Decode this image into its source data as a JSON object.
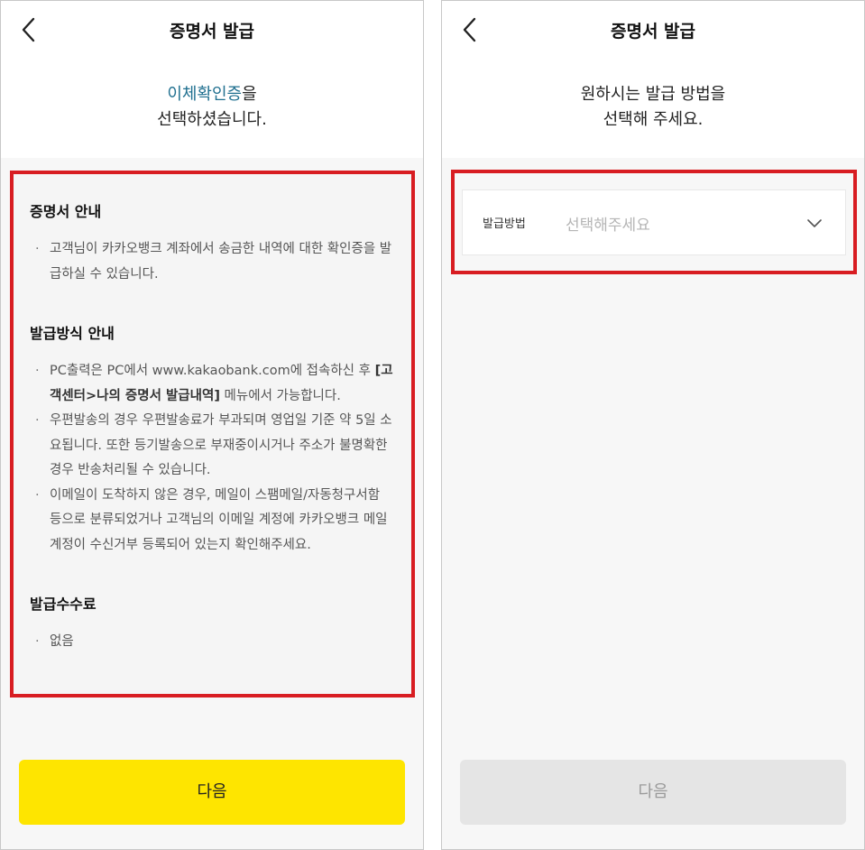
{
  "left": {
    "title": "증명서 발급",
    "headline": {
      "accent": "이체확인증",
      "suffix": "을",
      "line2": "선택하셨습니다."
    },
    "sections": {
      "cert": {
        "title": "증명서 안내",
        "items": [
          "고객님이 카카오뱅크 계좌에서 송금한 내역에 대한 확인증을 발급하실 수 있습니다."
        ]
      },
      "method": {
        "title": "발급방식 안내",
        "item1_part1": "PC출력은 PC에서 www.kakaobank.com에 접속하신 후 ",
        "item1_bold": "[고객센터>나의 증명서 발급내역]",
        "item1_part2": " 메뉴에서 가능합니다.",
        "item2": "우편발송의 경우 우편발송료가 부과되며 영업일 기준 약 5일 소요됩니다. 또한 등기발송으로 부재중이시거나 주소가 불명확한 경우 반송처리될 수 있습니다.",
        "item3": "이메일이 도착하지 않은 경우, 메일이 스팸메일/자동청구서함 등으로 분류되었거나 고객님의 이메일 계정에 카카오뱅크 메일 계정이 수신거부 등록되어 있는지 확인해주세요."
      },
      "fee": {
        "title": "발급수수료",
        "items": [
          "없음"
        ]
      }
    },
    "next_button": "다음"
  },
  "right": {
    "title": "증명서 발급",
    "headline": {
      "line1": "원하시는 발급 방법을",
      "line2": "선택해 주세요."
    },
    "select": {
      "label": "발급방법",
      "placeholder": "선택해주세요"
    },
    "next_button": "다음"
  },
  "colors": {
    "accent_text": "#1f6f8f",
    "primary_button": "#fee500",
    "highlight_border": "#d81d22",
    "disabled_button": "#e5e5e5"
  },
  "icons": {
    "back": "chevron-left-icon",
    "dropdown": "chevron-down-icon"
  }
}
